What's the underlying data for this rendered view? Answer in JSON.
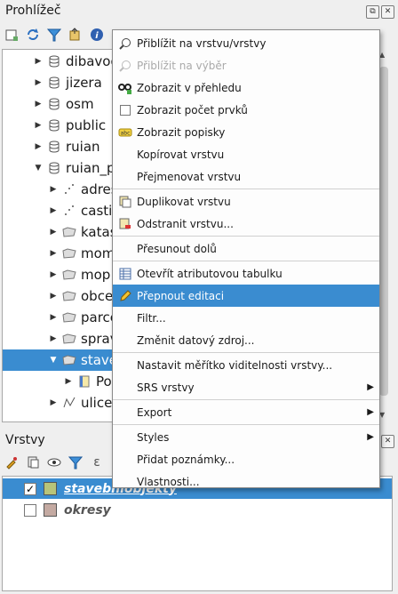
{
  "browser_panel": {
    "title": "Prohlížeč",
    "tree": [
      {
        "label": "dibavod",
        "indent": 1,
        "arrow": "right",
        "icon": "db"
      },
      {
        "label": "jizera",
        "indent": 1,
        "arrow": "right",
        "icon": "db"
      },
      {
        "label": "osm",
        "indent": 1,
        "arrow": "right",
        "icon": "db"
      },
      {
        "label": "public",
        "indent": 1,
        "arrow": "right",
        "icon": "db"
      },
      {
        "label": "ruian",
        "indent": 1,
        "arrow": "right",
        "icon": "db"
      },
      {
        "label": "ruian_praha",
        "indent": 1,
        "arrow": "down",
        "icon": "db"
      },
      {
        "label": "adresnimista",
        "indent": 2,
        "arrow": "right",
        "icon": "point"
      },
      {
        "label": "castiobci",
        "indent": 2,
        "arrow": "right",
        "icon": "point"
      },
      {
        "label": "katastralniuzemi",
        "indent": 2,
        "arrow": "right",
        "icon": "poly"
      },
      {
        "label": "momc",
        "indent": 2,
        "arrow": "right",
        "icon": "poly"
      },
      {
        "label": "mop",
        "indent": 2,
        "arrow": "right",
        "icon": "poly"
      },
      {
        "label": "obce",
        "indent": 2,
        "arrow": "right",
        "icon": "poly"
      },
      {
        "label": "parcely",
        "indent": 2,
        "arrow": "right",
        "icon": "poly"
      },
      {
        "label": "spravniobvody",
        "indent": 2,
        "arrow": "right",
        "icon": "poly"
      },
      {
        "label": "stavebniobjekty",
        "indent": 2,
        "arrow": "down",
        "icon": "poly",
        "selected": true
      },
      {
        "label": "Pole",
        "indent": 3,
        "arrow": "right",
        "icon": "fields"
      },
      {
        "label": "ulice",
        "indent": 2,
        "arrow": "right",
        "icon": "line"
      }
    ]
  },
  "layers_panel": {
    "title": "Vrstvy",
    "layers": [
      {
        "label": "stavebniobjekty",
        "checked": true,
        "color": "#b8c47a",
        "selected": true
      },
      {
        "label": "okresy",
        "checked": false,
        "color": "#c4aaa2",
        "selected": false
      }
    ]
  },
  "context_menu": {
    "items": [
      {
        "label": "Přiblížit na vrstvu/vrstvy",
        "icon": "zoom-layer-icon",
        "disabled": false
      },
      {
        "label": "Přiblížit na výběr",
        "icon": "zoom-selection-icon",
        "disabled": true
      },
      {
        "label": "Zobrazit v přehledu",
        "icon": "overview-icon",
        "disabled": false
      },
      {
        "label": "Zobrazit počet prvků",
        "icon": "checkbox-icon",
        "disabled": false
      },
      {
        "label": "Zobrazit popisky",
        "icon": "labels-icon",
        "disabled": false
      },
      {
        "label": "Kopírovat vrstvu",
        "icon": "",
        "disabled": false
      },
      {
        "label": "Přejmenovat vrstvu",
        "icon": "",
        "disabled": false,
        "separator_after": true
      },
      {
        "label": "Duplikovat vrstvu",
        "icon": "duplicate-icon",
        "disabled": false
      },
      {
        "label": "Odstranit vrstvu...",
        "icon": "remove-layer-icon",
        "disabled": false,
        "separator_after": true
      },
      {
        "label": "Přesunout dolů",
        "icon": "",
        "disabled": false,
        "separator_after": true
      },
      {
        "label": "Otevřít atributovou tabulku",
        "icon": "table-icon",
        "disabled": false
      },
      {
        "label": "Přepnout editaci",
        "icon": "pencil-icon",
        "disabled": false,
        "highlighted": true
      },
      {
        "label": "Filtr...",
        "icon": "",
        "disabled": false
      },
      {
        "label": "Změnit datový zdroj...",
        "icon": "",
        "disabled": false,
        "separator_after": true
      },
      {
        "label": "Nastavit měřítko viditelnosti vrstvy...",
        "icon": "",
        "disabled": false
      },
      {
        "label": "SRS vrstvy",
        "icon": "",
        "disabled": false,
        "submenu": true,
        "separator_after": true
      },
      {
        "label": "Export",
        "icon": "",
        "disabled": false,
        "submenu": true,
        "separator_after": true
      },
      {
        "label": "Styles",
        "icon": "",
        "disabled": false,
        "submenu": true
      },
      {
        "label": "Přidat poznámky...",
        "icon": "",
        "disabled": false
      },
      {
        "label": "Vlastnosti...",
        "icon": "",
        "disabled": false
      }
    ]
  }
}
